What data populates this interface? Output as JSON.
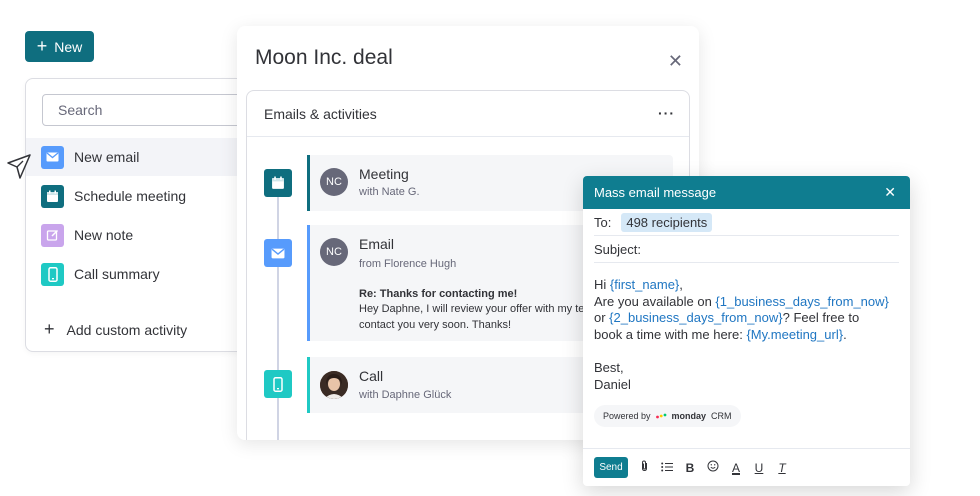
{
  "new_button": {
    "label": "New"
  },
  "menu": {
    "search_placeholder": "Search",
    "items": [
      {
        "label": "New email",
        "icon": "email-icon",
        "color": "#579bfc"
      },
      {
        "label": "Schedule meeting",
        "icon": "calendar-icon",
        "color": "#0f6e7f"
      },
      {
        "label": "New note",
        "icon": "note-icon",
        "color": "#a25ddc"
      },
      {
        "label": "Call summary",
        "icon": "phone-icon",
        "color": "#1fc9c4"
      }
    ],
    "add_custom": "Add custom activity"
  },
  "deal": {
    "title": "Moon Inc. deal",
    "section_title": "Emails & activities",
    "activities": [
      {
        "type": "Meeting",
        "subtitle": "with Nate G.",
        "avatar": "NC",
        "color": "#0f6e7f"
      },
      {
        "type": "Email",
        "subtitle": "from Florence Hugh",
        "avatar": "NC",
        "color": "#579bfc",
        "subject": "Re: Thanks for contacting me!",
        "body_line1": "Hey Daphne, I will review your offer with my te",
        "body_line2": "contact you very soon. Thanks!"
      },
      {
        "type": "Call",
        "subtitle": "with Daphne Glück",
        "avatar": "",
        "color": "#1fc9c4"
      }
    ]
  },
  "mass_email": {
    "title": "Mass email message",
    "to_label": "To:",
    "recipients": "498 recipients",
    "subject_label": "Subject:",
    "body": {
      "l1_a": "Hi ",
      "l1_var": "{first_name}",
      "l1_b": ",",
      "l2_a": "Are you available on ",
      "l2_var": "{1_business_days_from_now}",
      "l3_a": "or ",
      "l3_var": "{2_business_days_from_now}",
      "l3_b": "? Feel free to",
      "l4_a": "book a time with me here: ",
      "l4_var": "{My.meeting_url}",
      "l4_b": ".",
      "sign1": "Best,",
      "sign2": "Daniel"
    },
    "powered_by": "Powered by",
    "brand": "monday",
    "brand_suffix": "CRM",
    "send_label": "Send"
  }
}
